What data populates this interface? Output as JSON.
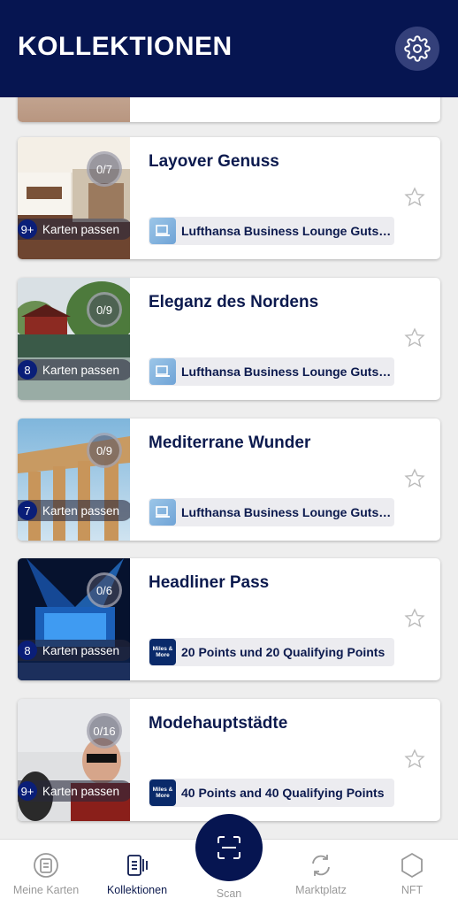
{
  "header": {
    "title": "KOLLEKTIONEN"
  },
  "collections": [
    {
      "title": "Layover Genuss",
      "progress": "0/7",
      "match_count": "9+",
      "match_label": "Karten passen",
      "reward": "Lufthansa Business Lounge Gutsc...",
      "reward_icon": "lounge-icon"
    },
    {
      "title": "Eleganz des Nordens",
      "progress": "0/9",
      "match_count": "8",
      "match_label": "Karten passen",
      "reward": "Lufthansa Business Lounge Gutsc...",
      "reward_icon": "lounge-icon"
    },
    {
      "title": "Mediterrane Wunder",
      "progress": "0/9",
      "match_count": "7",
      "match_label": "Karten passen",
      "reward": "Lufthansa Business Lounge Gutsc...",
      "reward_icon": "lounge-icon"
    },
    {
      "title": "Headliner Pass",
      "progress": "0/6",
      "match_count": "8",
      "match_label": "Karten passen",
      "reward": "20 Points und 20 Qualifying Points",
      "reward_icon": "miles-and-more-icon"
    },
    {
      "title": "Modehauptstädte",
      "progress": "0/16",
      "match_count": "9+",
      "match_label": "Karten passen",
      "reward": "40 Points and 40 Qualifying Points",
      "reward_icon": "miles-and-more-icon"
    }
  ],
  "miles_logo_text": "Miles & More",
  "nav": {
    "meine_karten": "Meine Karten",
    "kollektionen": "Kollektionen",
    "scan": "Scan",
    "marktplatz": "Marktplatz",
    "nft": "NFT"
  },
  "colors": {
    "brand": "#061551",
    "title": "#0c1a4e",
    "inactive": "#999999"
  }
}
